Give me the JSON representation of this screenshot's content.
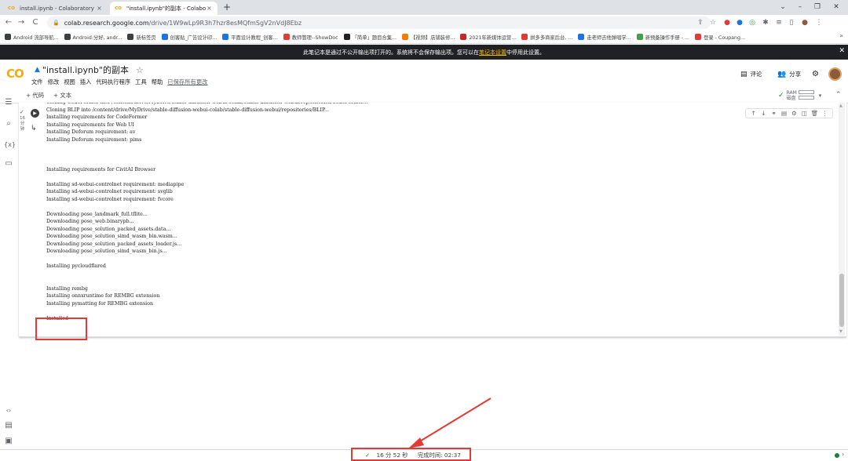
{
  "browser": {
    "tabs": [
      {
        "title": "install.ipynb - Colaboratory",
        "close": "×"
      },
      {
        "title": "\"install.ipynb\"的副本 - Colabo",
        "close": "×"
      }
    ],
    "new_tab": "+",
    "window_controls": [
      "⌄",
      "–",
      "❐",
      "✕"
    ],
    "nav": {
      "back": "←",
      "forward": "→",
      "reload": "C"
    },
    "url_host": "colab.research.google.com",
    "url_path": "/drive/1W9wLp9R3h7hzr8esMQfmSgV2nVdJ8Ebz",
    "bookmarks": [
      {
        "label": "Android 流部导航...",
        "color": "#3c4043"
      },
      {
        "label": "Android:分好, andr...",
        "color": "#3c4043"
      },
      {
        "label": "新标签页",
        "color": "#3c4043"
      },
      {
        "label": "创客贴_广告设计印...",
        "color": "#1a73e8"
      },
      {
        "label": "平面设计教程_创客...",
        "color": "#1a73e8"
      },
      {
        "label": "教师管理--ShowDoc",
        "color": "#e53935"
      },
      {
        "label": "「简单」题目合集...",
        "color": "#202124"
      },
      {
        "label": "【视频】店铺装修...",
        "color": "#f57c00"
      },
      {
        "label": "2021年新媒体运营...",
        "color": "#c62828"
      },
      {
        "label": "拼多多商家后台, ...",
        "color": "#e53935"
      },
      {
        "label": "走老师吉他弹唱学...",
        "color": "#1a73e8"
      },
      {
        "label": "新预备操作手册 - ...",
        "color": "#43a047"
      },
      {
        "label": "登录 - Coupang...",
        "color": "#e53935"
      }
    ],
    "bookmarks_more": "»"
  },
  "notice": {
    "text_before": "此笔记本是通过不公开输出项打开的。系统将不会保存输出项。您可以在",
    "link": "笔记本设置",
    "text_after": "中停用此设置。",
    "close": "✕"
  },
  "colab": {
    "logo": "CO",
    "title": "\"install.ipynb\"的副本",
    "menu": [
      "文件",
      "修改",
      "视图",
      "插入",
      "代码执行程序",
      "工具",
      "帮助"
    ],
    "save_all": "已保存所有更改",
    "comment_label": "评论",
    "share_label": "分享",
    "toolbar": {
      "add_code": "+ 代码",
      "add_text": "+ 文本"
    },
    "ram_label": "RAM",
    "disk_label": "磁盘"
  },
  "cell": {
    "duration": [
      "16",
      "分",
      "钟"
    ],
    "output_lines": [
      {
        "text": "Cloning CodeFormer into /content/drive/MyDrive/stable-diffusion-webui-colab/stable-diffusion-webui/repositories/CodeFormer...",
        "cut": true
      },
      {
        "text": "Cloning BLIP into /content/drive/MyDrive/stable-diffusion-webui-colab/stable-diffusion-webui/repositories/BLIP..."
      },
      {
        "text": "Installing requirements for CodeFormer"
      },
      {
        "text": "Installing requirements for Web UI"
      },
      {
        "text": "Installing Deforum requirement: av"
      },
      {
        "text": "Installing Deforum requirement: pims"
      },
      {
        "text": ""
      },
      {
        "text": ""
      },
      {
        "text": ""
      },
      {
        "text": "Installing requirements for CivitAI Browser"
      },
      {
        "text": ""
      },
      {
        "text": "Installing sd-webui-controlnet requirement: mediapipe"
      },
      {
        "text": "Installing sd-webui-controlnet requirement: svglib"
      },
      {
        "text": "Installing sd-webui-controlnet requirement: fvcore"
      },
      {
        "text": ""
      },
      {
        "text": "Downloading pose_landmark_full.tflite..."
      },
      {
        "text": "Downloading pose_web.binarypb..."
      },
      {
        "text": "Downloading pose_solution_packed_assets.data..."
      },
      {
        "text": "Downloading pose_solution_simd_wasm_bin.wasm..."
      },
      {
        "text": "Downloading pose_solution_packed_assets_loader.js..."
      },
      {
        "text": "Downloading pose_solution_simd_wasm_bin.js..."
      },
      {
        "text": ""
      },
      {
        "text": "Installing pycloudflared"
      },
      {
        "text": ""
      },
      {
        "text": ""
      },
      {
        "text": "Installing rembg"
      },
      {
        "text": "Installing onnxruntime for REMBG extension"
      },
      {
        "text": "Installing pymatting for REMBG extension"
      },
      {
        "text": ""
      },
      {
        "text": "Installed"
      }
    ]
  },
  "status": {
    "check": "✓",
    "elapsed": "16 分 52 秒",
    "finished_label": "完成时间: 02:37"
  }
}
